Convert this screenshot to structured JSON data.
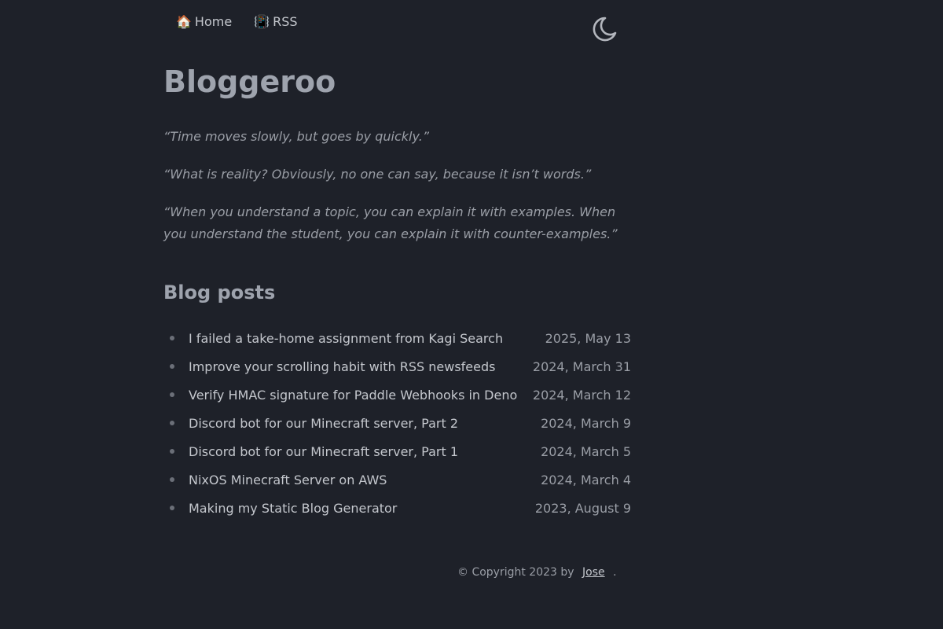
{
  "nav": {
    "home": {
      "emoji": "🏠",
      "label": "Home"
    },
    "rss": {
      "emoji": "📳",
      "label": "RSS"
    }
  },
  "theme_toggle": {
    "icon": "moon-icon"
  },
  "title": "Bloggeroo",
  "quotes": [
    "“Time moves slowly, but goes by quickly.”",
    "“What is reality? Obviously, no one can say, because it isn’t words.”",
    "“When you understand a topic, you can explain it with examples. When you understand the student, you can explain it with counter-examples.”"
  ],
  "blog_section": {
    "title": "Blog posts",
    "posts": [
      {
        "title": "I failed a take-home assignment from Kagi Search",
        "date": "2025, May 13"
      },
      {
        "title": "Improve your scrolling habit with RSS newsfeeds",
        "date": "2024, March 31"
      },
      {
        "title": "Verify HMAC signature for Paddle Webhooks in Deno",
        "date": "2024, March 12"
      },
      {
        "title": "Discord bot for our Minecraft server, Part 2",
        "date": "2024, March 9"
      },
      {
        "title": "Discord bot for our Minecraft server, Part 1",
        "date": "2024, March 5"
      },
      {
        "title": "NixOS Minecraft Server on AWS",
        "date": "2024, March 4"
      },
      {
        "title": "Making my Static Blog Generator",
        "date": "2023, August 9"
      }
    ]
  },
  "footer": {
    "copyright": "© Copyright 2023 by",
    "author": "Jose",
    "end": "."
  },
  "colors": {
    "background": "#1e2129",
    "text": "#b3b6bd",
    "muted": "#9a9ea6"
  }
}
